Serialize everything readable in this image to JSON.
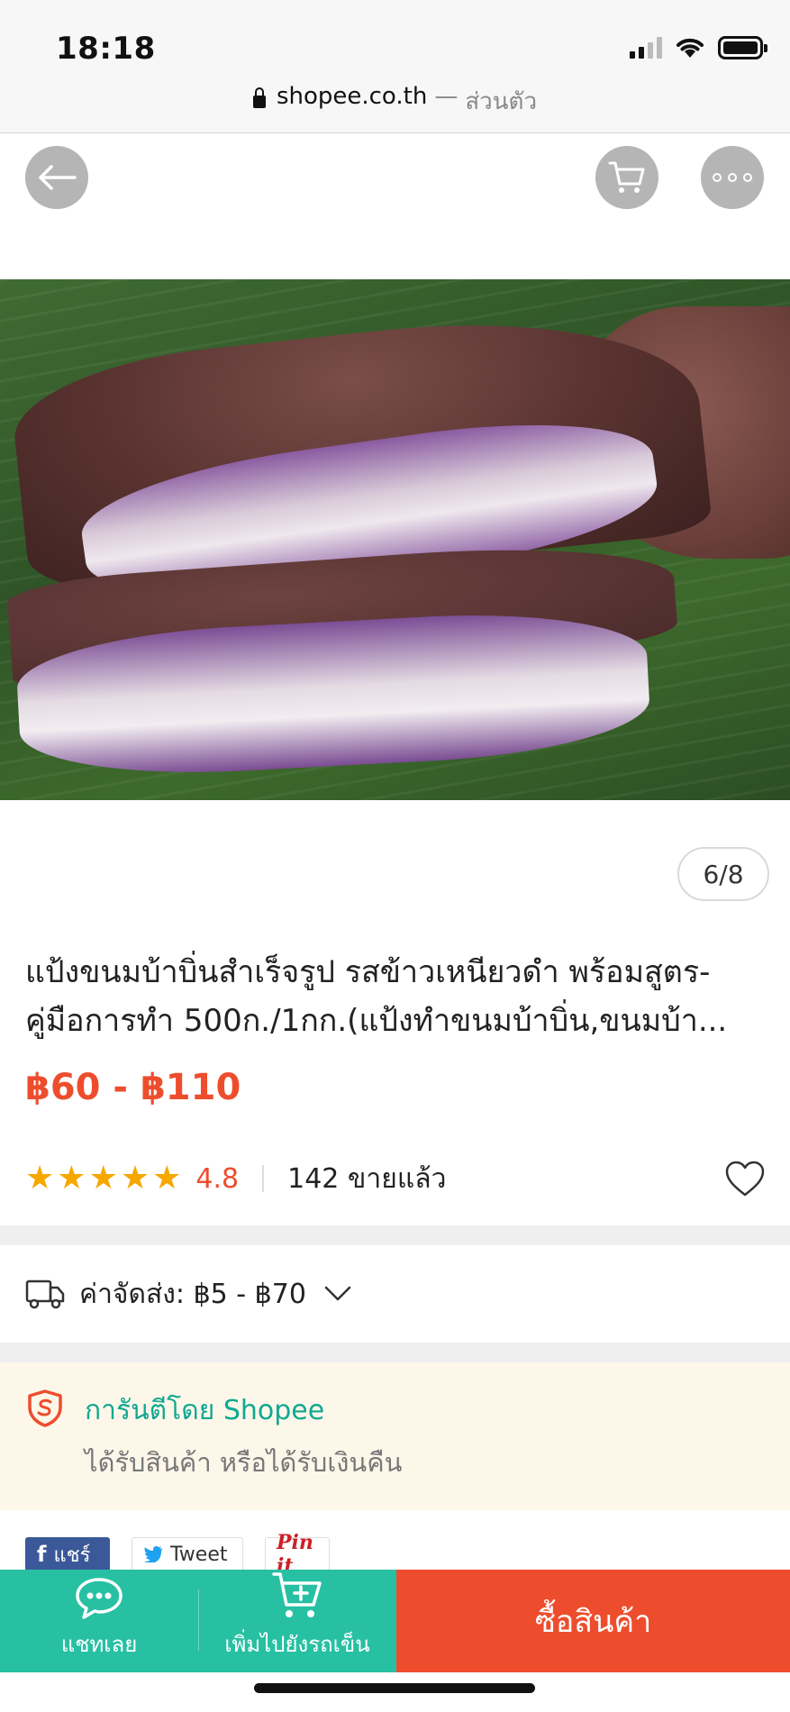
{
  "status_bar": {
    "time": "18:18"
  },
  "browser": {
    "domain": "shopee.co.th",
    "separator": "—",
    "mode": "ส่วนตัว"
  },
  "gallery": {
    "counter": "6/8",
    "icons": [
      "back-arrow-icon",
      "cart-icon",
      "more-icon"
    ]
  },
  "product": {
    "title": "แป้งขนมบ้าบิ่นสำเร็จรูป รสข้าวเหนียวดำ พร้อมสูตร-คู่มือการทำ 500ก./1กก.(แป้งทำขนมบ้าบิ่น,ขนมบ้า...",
    "price": "฿60 - ฿110",
    "rating": "4.8",
    "stars": 5,
    "sold": "142 ขายแล้ว"
  },
  "shipping": {
    "label": "ค่าจัดส่ง: ฿5 - ฿70"
  },
  "guarantee": {
    "title": "การันตีโดย Shopee",
    "subtitle": "ได้รับสินค้า หรือได้รับเงินคืน"
  },
  "share": {
    "facebook": "แชร์",
    "twitter": "Tweet",
    "pinterest": "Pin it"
  },
  "bottom_bar": {
    "chat": "แชทเลย",
    "add_to_cart": "เพิ่มไปยังรถเข็น",
    "buy": "ซื้อสินค้า"
  },
  "colors": {
    "accent": "#ee4d2d",
    "teal": "#27c0a3",
    "star": "#f6a700"
  }
}
